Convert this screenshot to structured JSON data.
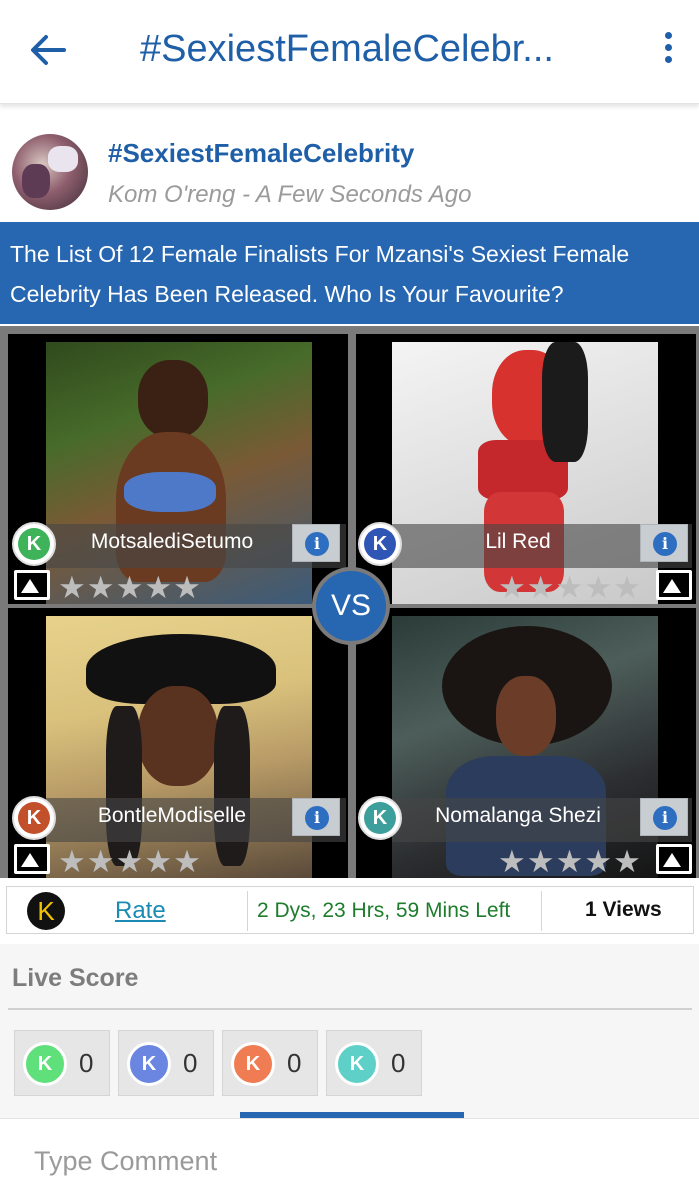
{
  "topbar": {
    "title": "#SexiestFemaleCelebr...",
    "back_icon": "arrow-left-icon",
    "menu_icon": "more-vert-icon"
  },
  "post": {
    "title": "#SexiestFemaleCelebrity",
    "meta": "Kom O'reng - A Few Seconds Ago",
    "banner": "The List Of 12 Female Finalists For Mzansi's Sexiest Female Celebrity Has Been Released. Who Is Your Favourite?"
  },
  "contestants": [
    {
      "name": "MotsalediSetumo",
      "badge_color": "#3fb35a",
      "stars": "★★★★★",
      "info": "i"
    },
    {
      "name": "Lil Red",
      "badge_color": "#2f55b5",
      "stars": "★★★★★",
      "info": "i"
    },
    {
      "name": "BontleModiselle",
      "badge_color": "#c2502b",
      "stars": "★★★★★",
      "info": "i"
    },
    {
      "name": "Nomalanga Shezi",
      "badge_color": "#3d9f9b",
      "stars": "★★★★★",
      "info": "i"
    }
  ],
  "vs_label": "VS",
  "rating": {
    "rate_label": "Rate",
    "time_left": "2 Dys, 23 Hrs, 59 Mins Left",
    "views": "1 Views"
  },
  "live_score": {
    "title": "Live Score",
    "scores": [
      {
        "color": "#5fe07b",
        "value": "0"
      },
      {
        "color": "#6a86e0",
        "value": "0"
      },
      {
        "color": "#f07c53",
        "value": "0"
      },
      {
        "color": "#5fd0c8",
        "value": "0"
      }
    ]
  },
  "comment": {
    "placeholder": "Type Comment"
  }
}
